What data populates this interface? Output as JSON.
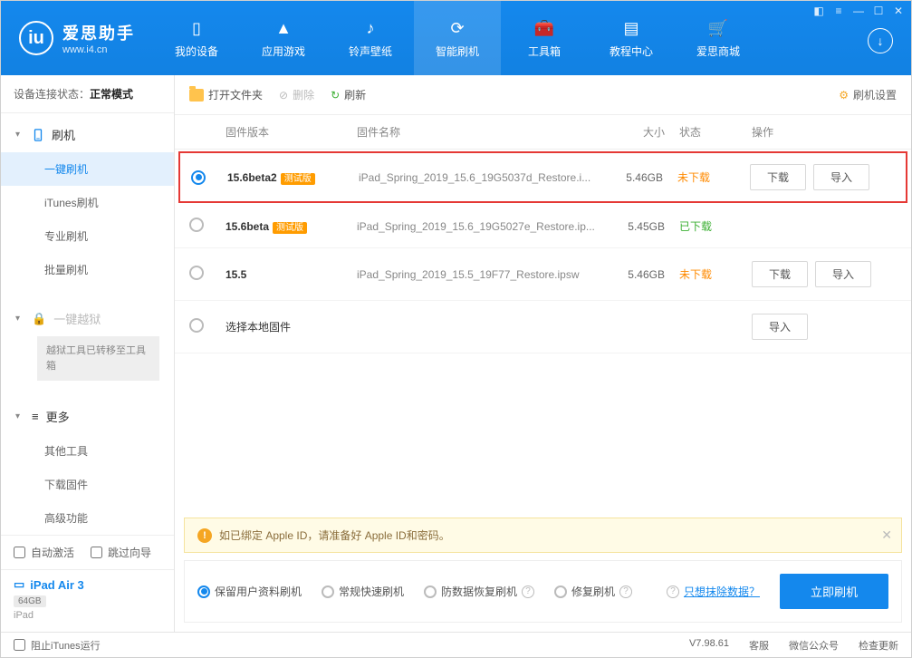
{
  "logo": {
    "title": "爱思助手",
    "url": "www.i4.cn"
  },
  "nav": [
    {
      "label": "我的设备"
    },
    {
      "label": "应用游戏"
    },
    {
      "label": "铃声壁纸"
    },
    {
      "label": "智能刷机"
    },
    {
      "label": "工具箱"
    },
    {
      "label": "教程中心"
    },
    {
      "label": "爱思商城"
    }
  ],
  "sidebar": {
    "conn_label": "设备连接状态：",
    "conn_value": "正常模式",
    "flash_head": "刷机",
    "items": [
      "一键刷机",
      "iTunes刷机",
      "专业刷机",
      "批量刷机"
    ],
    "jailbreak_head": "一键越狱",
    "jailbreak_note": "越狱工具已转移至工具箱",
    "more_head": "更多",
    "more_items": [
      "其他工具",
      "下载固件",
      "高级功能"
    ],
    "auto_activate": "自动激活",
    "skip_guide": "跳过向导",
    "device_name": "iPad Air 3",
    "device_storage": "64GB",
    "device_type": "iPad"
  },
  "toolbar": {
    "open_folder": "打开文件夹",
    "delete": "删除",
    "refresh": "刷新",
    "settings": "刷机设置"
  },
  "table": {
    "headers": {
      "version": "固件版本",
      "name": "固件名称",
      "size": "大小",
      "status": "状态",
      "ops": "操作"
    },
    "rows": [
      {
        "version": "15.6beta2",
        "badge": "测试版",
        "name": "iPad_Spring_2019_15.6_19G5037d_Restore.i...",
        "size": "5.46GB",
        "status": "未下载",
        "status_class": "not",
        "selected": true,
        "highlighted": true,
        "show_ops": true
      },
      {
        "version": "15.6beta",
        "badge": "测试版",
        "name": "iPad_Spring_2019_15.6_19G5027e_Restore.ip...",
        "size": "5.45GB",
        "status": "已下载",
        "status_class": "done",
        "selected": false,
        "highlighted": false,
        "show_ops": false
      },
      {
        "version": "15.5",
        "badge": "",
        "name": "iPad_Spring_2019_15.5_19F77_Restore.ipsw",
        "size": "5.46GB",
        "status": "未下载",
        "status_class": "not",
        "selected": false,
        "highlighted": false,
        "show_ops": true
      }
    ],
    "local_row": "选择本地固件",
    "btn_download": "下载",
    "btn_import": "导入"
  },
  "notice": "如已绑定 Apple ID，请准备好 Apple ID和密码。",
  "options": {
    "keep_data": "保留用户资料刷机",
    "normal": "常规快速刷机",
    "anti_loss": "防数据恢复刷机",
    "repair": "修复刷机",
    "erase_link": "只想抹除数据？",
    "flash_btn": "立即刷机"
  },
  "footer": {
    "block_itunes": "阻止iTunes运行",
    "version": "V7.98.61",
    "support": "客服",
    "wechat": "微信公众号",
    "update": "检查更新"
  }
}
